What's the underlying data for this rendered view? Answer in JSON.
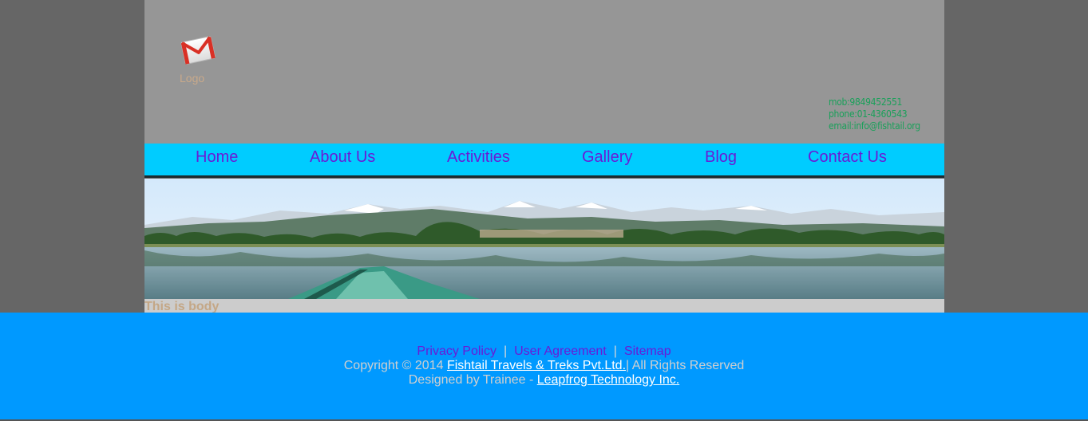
{
  "header": {
    "logo_icon": "gmail-envelope-icon",
    "logo_label": "Logo",
    "contact": {
      "mob": "mob:9849452551",
      "phone": "phone:01-4360543",
      "email": "email:info@fishtail.org"
    }
  },
  "nav": {
    "items": [
      {
        "label": "Home"
      },
      {
        "label": "About Us"
      },
      {
        "label": "Activities"
      },
      {
        "label": "Gallery"
      },
      {
        "label": "Blog"
      },
      {
        "label": "Contact Us"
      }
    ]
  },
  "banner": {
    "image": "lake-mountain-panorama"
  },
  "body": {
    "text": "This is body"
  },
  "footer": {
    "links": {
      "privacy": "Privacy Policy",
      "separator": "|",
      "agreement": "User Agreement",
      "sitemap": "Sitemap"
    },
    "copyright_prefix": "Copyright © 2014",
    "company_link": "Fishtail Travels & Treks Pvt.Ltd.",
    "rights": "| All Rights Reserved",
    "designed_prefix": "Designed by Trainee -",
    "designer_link": "Leapfrog Technology Inc."
  },
  "colors": {
    "page_bg": "#666666",
    "header_bg": "#969696",
    "nav_bg": "#00ccff",
    "nav_link": "#6a1bd6",
    "footer_bg": "#0099ff",
    "contact_text": "#1aa05a"
  }
}
